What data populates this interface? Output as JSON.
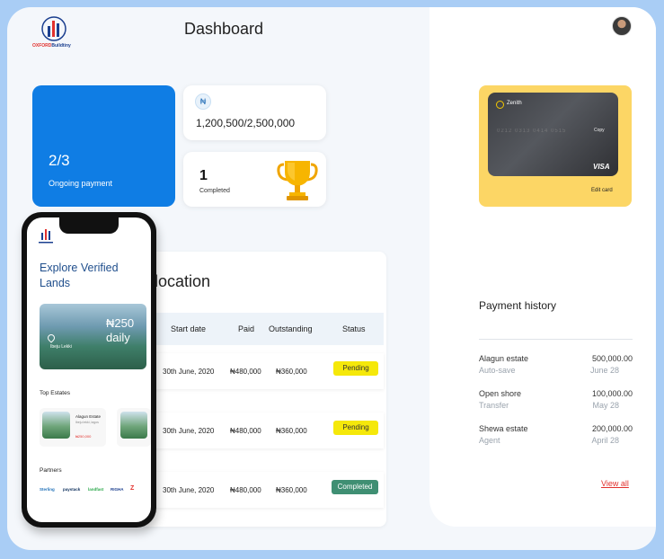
{
  "header": {
    "logo_text_1": "OXFORD",
    "logo_text_2": "Buildtiny",
    "title": "Dashboard"
  },
  "stats": {
    "ongoing_value": "2/3",
    "ongoing_label": "Ongoing payment",
    "currency_symbol": "₦",
    "amount": "1,200,500/2,500,000",
    "completed_value": "1",
    "completed_label": "Completed"
  },
  "allocation": {
    "title": "location",
    "columns": [
      "Start date",
      "Paid",
      "Outstanding",
      "Status"
    ],
    "rows": [
      {
        "start": "30th June, 2020",
        "paid": "₦480,000",
        "outstanding": "₦360,000",
        "status": "Pending"
      },
      {
        "start": "30th June, 2020",
        "paid": "₦480,000",
        "outstanding": "₦360,000",
        "status": "Pending"
      },
      {
        "start": "30th June, 2020",
        "paid": "₦480,000",
        "outstanding": "₦360,000",
        "status": "Completed"
      }
    ]
  },
  "card": {
    "bank": "Zenith",
    "copy": "Copy",
    "number": "0212 0313 0414 0515",
    "brand": "VISA",
    "edit_label": "Edit card"
  },
  "payment_history": {
    "title": "Payment history",
    "items": [
      {
        "name": "Alagun estate",
        "type": "Auto-save",
        "amount": "500,000.00",
        "date": "June 28"
      },
      {
        "name": "Open shore",
        "type": "Transfer",
        "amount": "100,000.00",
        "date": "May 28"
      },
      {
        "name": "Shewa estate",
        "type": "Agent",
        "amount": "200,000.00",
        "date": "April 28"
      }
    ],
    "view_all": "View all"
  },
  "phone": {
    "heading": "Explore Verified Lands",
    "land_price": "₦250",
    "land_unit": "daily",
    "land_location": "Ibeju Lekki",
    "top_estates_title": "Top Estates",
    "estate_name": "Alagun Estate",
    "estate_location": "Ibeju lekki, lagos",
    "estate_price": "₦250,000",
    "partners_title": "Partners",
    "partners": [
      "Sterling",
      "paystack",
      "landfast",
      "RIGHA",
      "Z"
    ]
  },
  "colors": {
    "primary": "#0f7de4",
    "card_bg": "#fcd665",
    "pending": "#f5e80a",
    "completed": "#3f8f73",
    "link": "#e2312d"
  }
}
